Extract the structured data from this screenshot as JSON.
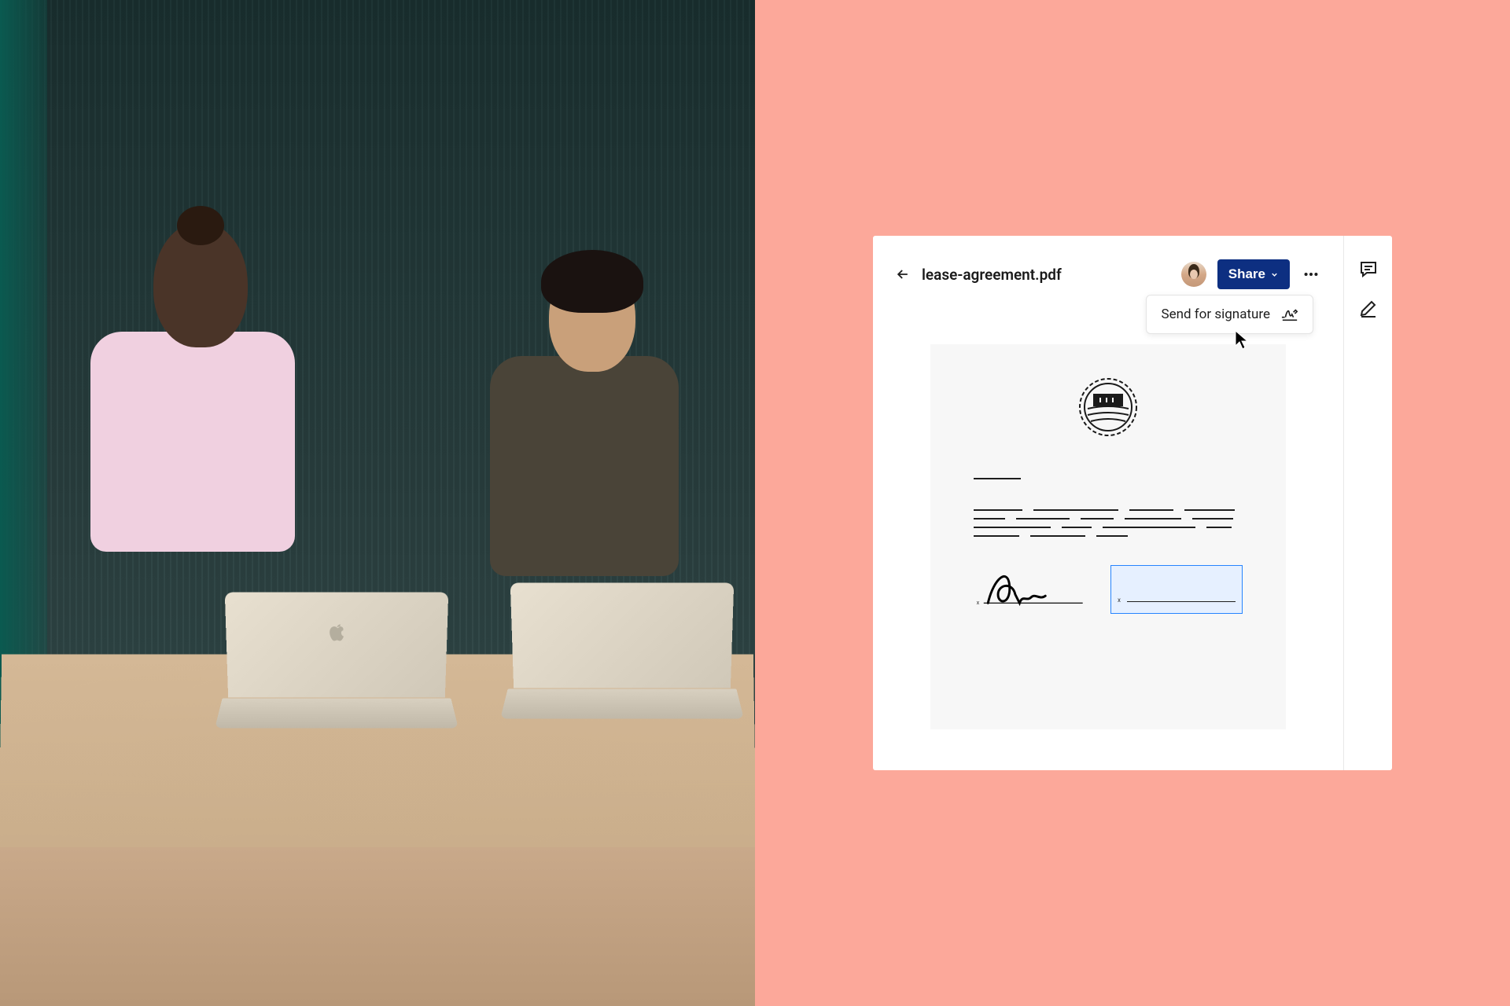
{
  "file": {
    "name": "lease-agreement.pdf"
  },
  "header": {
    "share_label": "Share"
  },
  "tooltip": {
    "label": "Send for signature"
  }
}
